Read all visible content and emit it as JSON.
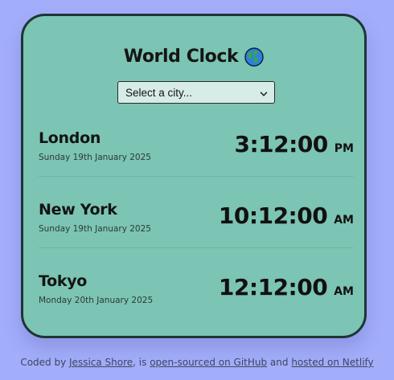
{
  "header": {
    "title": "World Clock"
  },
  "city_select": {
    "selected": "Select a city..."
  },
  "cities": [
    {
      "name": "London",
      "date": "Sunday 19th January 2025",
      "time": "3:12:00",
      "ampm": "PM"
    },
    {
      "name": "New York",
      "date": "Sunday 19th January 2025",
      "time": "10:12:00",
      "ampm": "AM"
    },
    {
      "name": "Tokyo",
      "date": "Monday 20th January 2025",
      "time": "12:12:00",
      "ampm": "AM"
    }
  ],
  "footer": {
    "prefix": "Coded by ",
    "author_link": "Jessica Shore",
    "middle1": ", is ",
    "github_link": "open-sourced on GitHub",
    "middle2": " and ",
    "netlify_link": "hosted on Netlify"
  },
  "colors": {
    "background": "#a3aefa",
    "card": "#7cc4b3",
    "card_border": "#1f3535"
  },
  "icons": {
    "title_icon": "globe-icon",
    "select_icon": "chevron-down-icon"
  }
}
